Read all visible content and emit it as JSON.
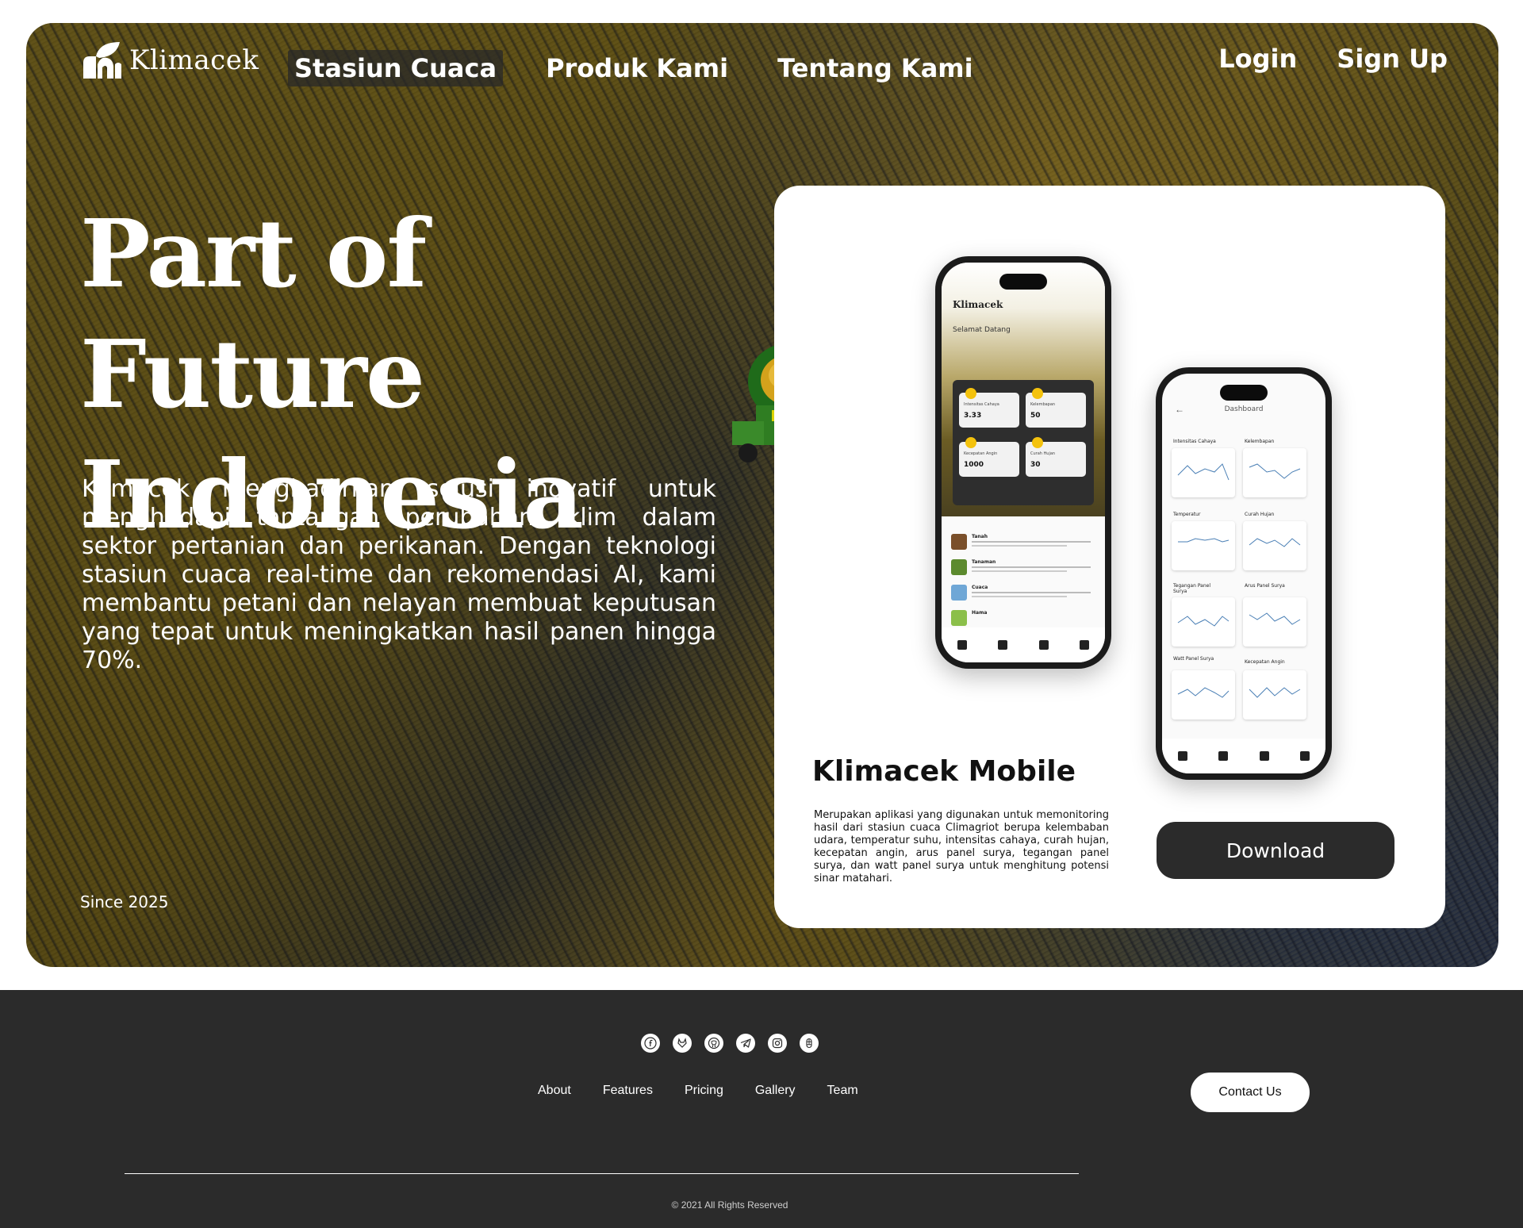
{
  "header": {
    "logo_text": "Klimacek",
    "nav": [
      {
        "label": "Stasiun Cuaca",
        "active": true
      },
      {
        "label": "Produk Kami",
        "active": false
      },
      {
        "label": "Tentang Kami",
        "active": false
      }
    ],
    "login_label": "Login",
    "signup_label": "Sign Up"
  },
  "hero": {
    "headline_line1": "Part of Future",
    "headline_line2": "Indonesia",
    "lead": "Klimacek menghadirkan solusi inovatif untuk menghadapi tantangan perubahan iklim dalam sektor pertanian dan perikanan. Dengan teknologi stasiun cuaca real-time dan rekomendasi AI, kami membantu petani dan nelayan membuat keputusan yang tepat untuk meningkatkan hasil panen hingga 70%.",
    "since": "Since 2025"
  },
  "card": {
    "title": "Klimacek Mobile",
    "description": "Merupakan aplikasi yang digunakan untuk memonitoring hasil dari stasiun cuaca Climagriot berupa kelembaban udara, temperatur suhu, intensitas cahaya, curah hujan, kecepatan angin, arus panel surya, tegangan panel surya, dan watt panel surya untuk menghitung potensi sinar matahari.",
    "download_label": "Download"
  },
  "phone_home": {
    "logo": "Klimacek",
    "greeting": "Selamat Datang",
    "stats": [
      {
        "label": "Intensitas Cahaya",
        "value": "3.33"
      },
      {
        "label": "Kelembapan",
        "value": "50"
      },
      {
        "label": "Kecepatan Angin",
        "value": "1000"
      },
      {
        "label": "Curah Hujan",
        "value": "30"
      }
    ],
    "news": [
      "Tanah",
      "Tanaman",
      "Cuaca",
      "Hama"
    ]
  },
  "phone_dashboard": {
    "title": "Dashboard",
    "charts": [
      "Intensitas Cahaya",
      "Kelembapan",
      "Temperatur",
      "Curah Hujan",
      "Tegangan Panel Surya",
      "Arus Panel Surya",
      "Watt Panel Surya",
      "Kecepatan Angin"
    ]
  },
  "footer": {
    "social_icons": [
      "facebook-icon",
      "gitlab-icon",
      "github-icon",
      "telegram-icon",
      "instagram-icon",
      "figma-icon"
    ],
    "links": [
      "About",
      "Features",
      "Pricing",
      "Gallery",
      "Team"
    ],
    "contact_label": "Contact Us",
    "copyright": "© 2021 All Rights Reserved"
  }
}
